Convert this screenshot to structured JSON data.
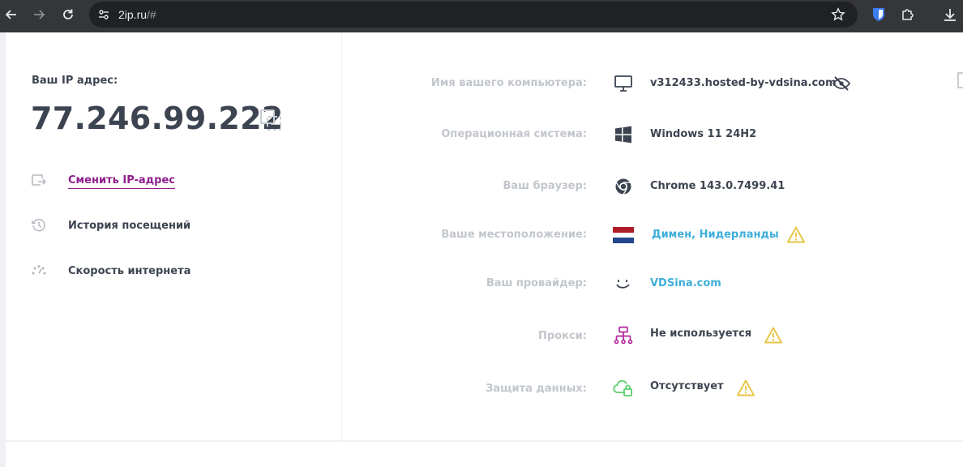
{
  "browser": {
    "url_host": "2ip.ru",
    "url_path": "/#"
  },
  "left": {
    "ip_label": "Ваш IP адрес:",
    "ip_value": "77.246.99.222",
    "menu": [
      {
        "label": "Сменить IP-адрес",
        "icon": "change-ip-icon"
      },
      {
        "label": "История посещений",
        "icon": "history-icon"
      },
      {
        "label": "Скорость интернета",
        "icon": "speed-icon"
      }
    ]
  },
  "info": {
    "computer": {
      "label": "Имя вашего компьютера:",
      "value": "v312433.hosted-by-vdsina.com"
    },
    "os": {
      "label": "Операционная система:",
      "value": "Windows 11 24H2"
    },
    "browser": {
      "label": "Ваш браузер:",
      "value": "Chrome 143.0.7499.41"
    },
    "location": {
      "label": "Ваше местоположение:",
      "value": "Димен, Нидерланды"
    },
    "provider": {
      "label": "Ваш провайдер:",
      "value": "VDSina.com"
    },
    "proxy": {
      "label": "Прокси:",
      "value": "Не используется"
    },
    "protection": {
      "label": "Защита данных:",
      "value": "Отсутствует"
    }
  },
  "colors": {
    "link_purple": "#8e1f8e",
    "link_blue": "#3eaed9",
    "warning_yellow": "#e8c64a",
    "proxy_magenta": "#b0259f",
    "cloud_green": "#5ad16a"
  }
}
